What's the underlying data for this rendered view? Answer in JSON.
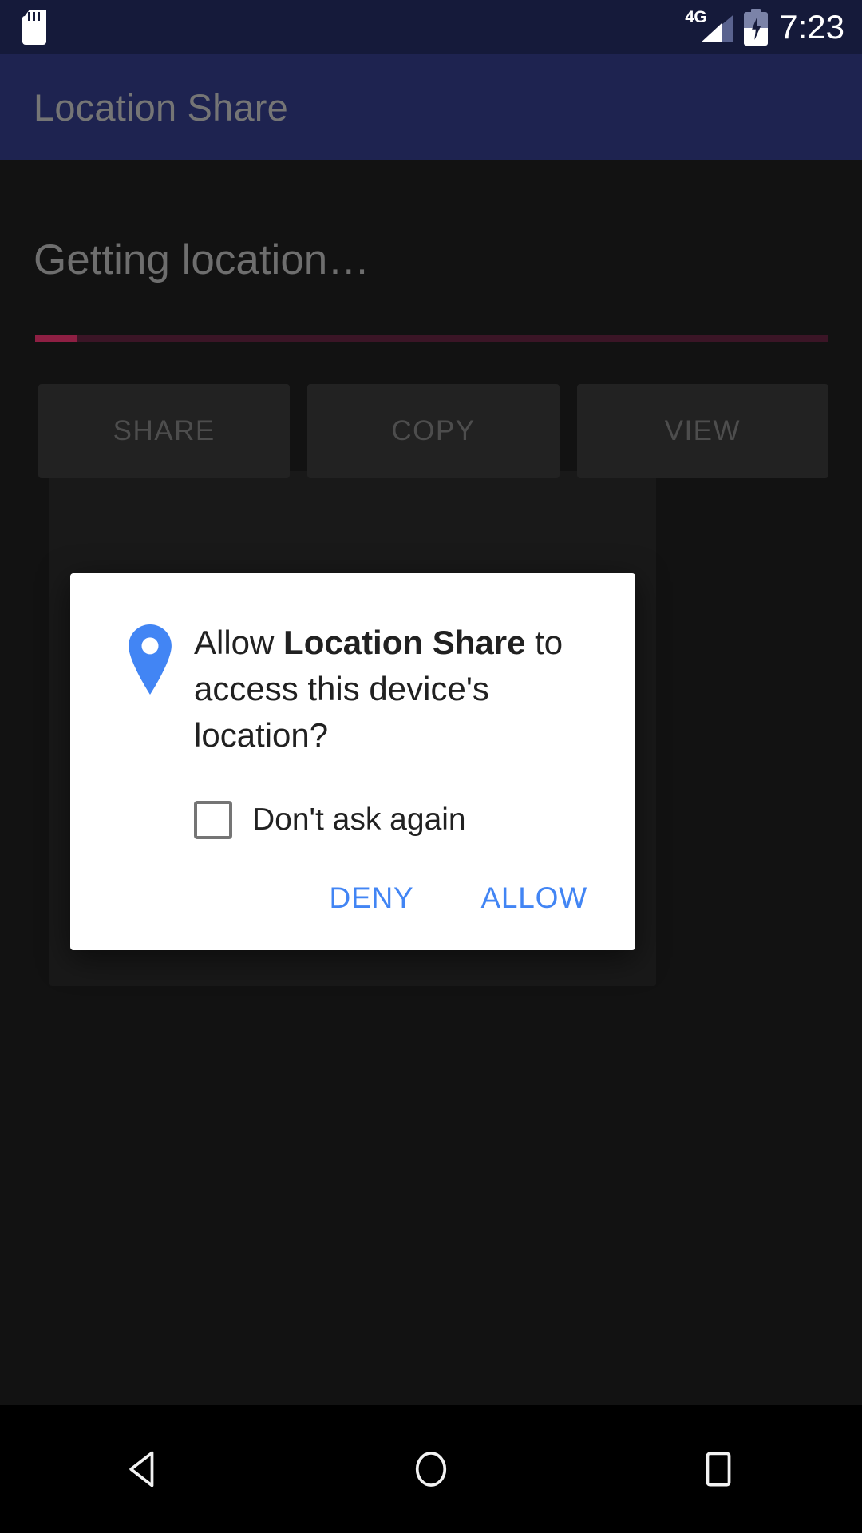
{
  "status_bar": {
    "sd_card_icon": "sd-card-icon",
    "network_label": "4G",
    "signal_icon": "signal-bars-icon",
    "battery_icon": "battery-charging-icon",
    "time": "7:23"
  },
  "app_bar": {
    "title": "Location Share"
  },
  "main": {
    "status_text": "Getting location…",
    "progress": {
      "indeterminate": true,
      "track_color": "#3b1526",
      "fill_color": "#8e1f43"
    },
    "buttons": [
      {
        "label": "SHARE",
        "name": "share-button",
        "enabled": false
      },
      {
        "label": "COPY",
        "name": "copy-button",
        "enabled": false
      },
      {
        "label": "VIEW",
        "name": "view-button",
        "enabled": false
      }
    ]
  },
  "dialog": {
    "icon": "location-pin-icon",
    "icon_color": "#4285f4",
    "message_prefix": "Allow ",
    "message_app": "Location Share",
    "message_suffix": " to access this device's location?",
    "checkbox": {
      "label": "Don't ask again",
      "checked": false
    },
    "actions": {
      "deny_label": "DENY",
      "allow_label": "ALLOW",
      "color": "#4285f4"
    }
  },
  "nav_bar": {
    "back": "back-triangle-icon",
    "home": "home-circle-icon",
    "recents": "recents-square-icon"
  }
}
